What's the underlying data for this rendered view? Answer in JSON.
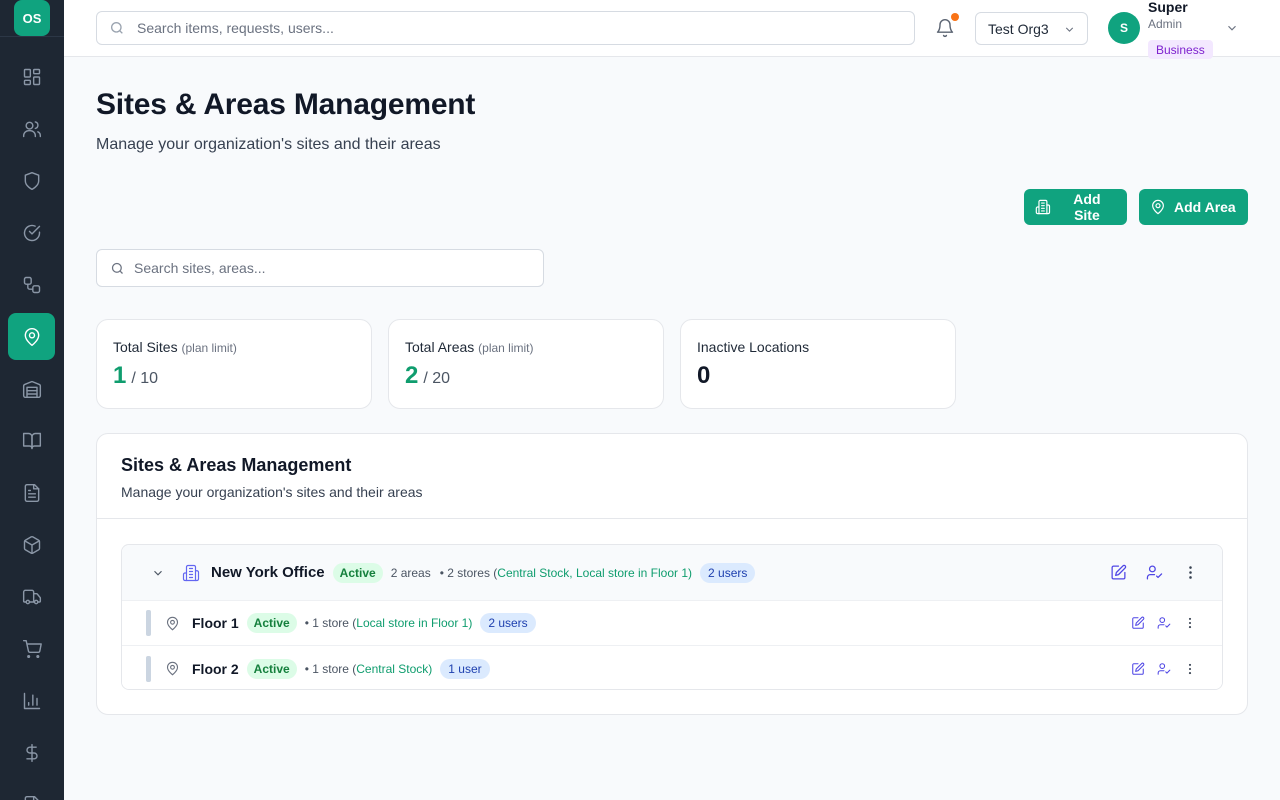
{
  "app": {
    "logo_text": "OS"
  },
  "sidebar": {
    "items": [
      {
        "name": "dashboard",
        "icon": "grid-icon"
      },
      {
        "name": "users",
        "icon": "users-icon"
      },
      {
        "name": "security",
        "icon": "shield-icon"
      },
      {
        "name": "approvals",
        "icon": "check-circle-icon"
      },
      {
        "name": "workflows",
        "icon": "workflow-icon"
      },
      {
        "name": "locations",
        "icon": "map-pin-icon",
        "active": true
      },
      {
        "name": "inventory",
        "icon": "warehouse-icon"
      },
      {
        "name": "catalog",
        "icon": "book-icon"
      },
      {
        "name": "documents",
        "icon": "file-text-icon"
      },
      {
        "name": "items",
        "icon": "package-icon"
      },
      {
        "name": "shipping",
        "icon": "truck-icon"
      },
      {
        "name": "purchasing",
        "icon": "cart-icon"
      },
      {
        "name": "reports",
        "icon": "bar-chart-icon"
      },
      {
        "name": "finance",
        "icon": "dollar-icon"
      }
    ]
  },
  "topbar": {
    "search_placeholder": "Search items, requests, users...",
    "org_name": "Test Org3",
    "user": {
      "initial": "S",
      "name": "Super",
      "role": "Admin",
      "plan": "Business"
    },
    "colors": {
      "accent": "#10a37f",
      "notification_dot": "#f97316"
    }
  },
  "page": {
    "title": "Sites & Areas Management",
    "subtitle": "Manage your organization's sites and their areas",
    "add_site_label": "Add Site",
    "add_area_label": "Add Area",
    "search_placeholder": "Search sites, areas..."
  },
  "stats": [
    {
      "label": "Total Sites",
      "hint": "(plan limit)",
      "value": "1",
      "limit": "/ 10"
    },
    {
      "label": "Total Areas",
      "hint": "(plan limit)",
      "value": "2",
      "limit": "/ 20"
    },
    {
      "label": "Inactive Locations",
      "value": "0"
    }
  ],
  "panel": {
    "title": "Sites & Areas Management",
    "subtitle": "Manage your organization's sites and their areas",
    "site": {
      "name": "New York Office",
      "status": "Active",
      "areas": "2 areas",
      "stores_prefix": "• 2 stores (",
      "stores_list": "Central Stock, Local store in Floor 1",
      "stores_suffix": ")",
      "users": "2 users",
      "children": [
        {
          "name": "Floor 1",
          "status": "Active",
          "stores_prefix": "• 1 store (",
          "stores_list": "Local store in Floor 1",
          "stores_suffix": ")",
          "users": "2 users"
        },
        {
          "name": "Floor 2",
          "status": "Active",
          "stores_prefix": "• 1 store (",
          "stores_list": "Central Stock",
          "stores_suffix": ")",
          "users": "1 user"
        }
      ]
    }
  }
}
